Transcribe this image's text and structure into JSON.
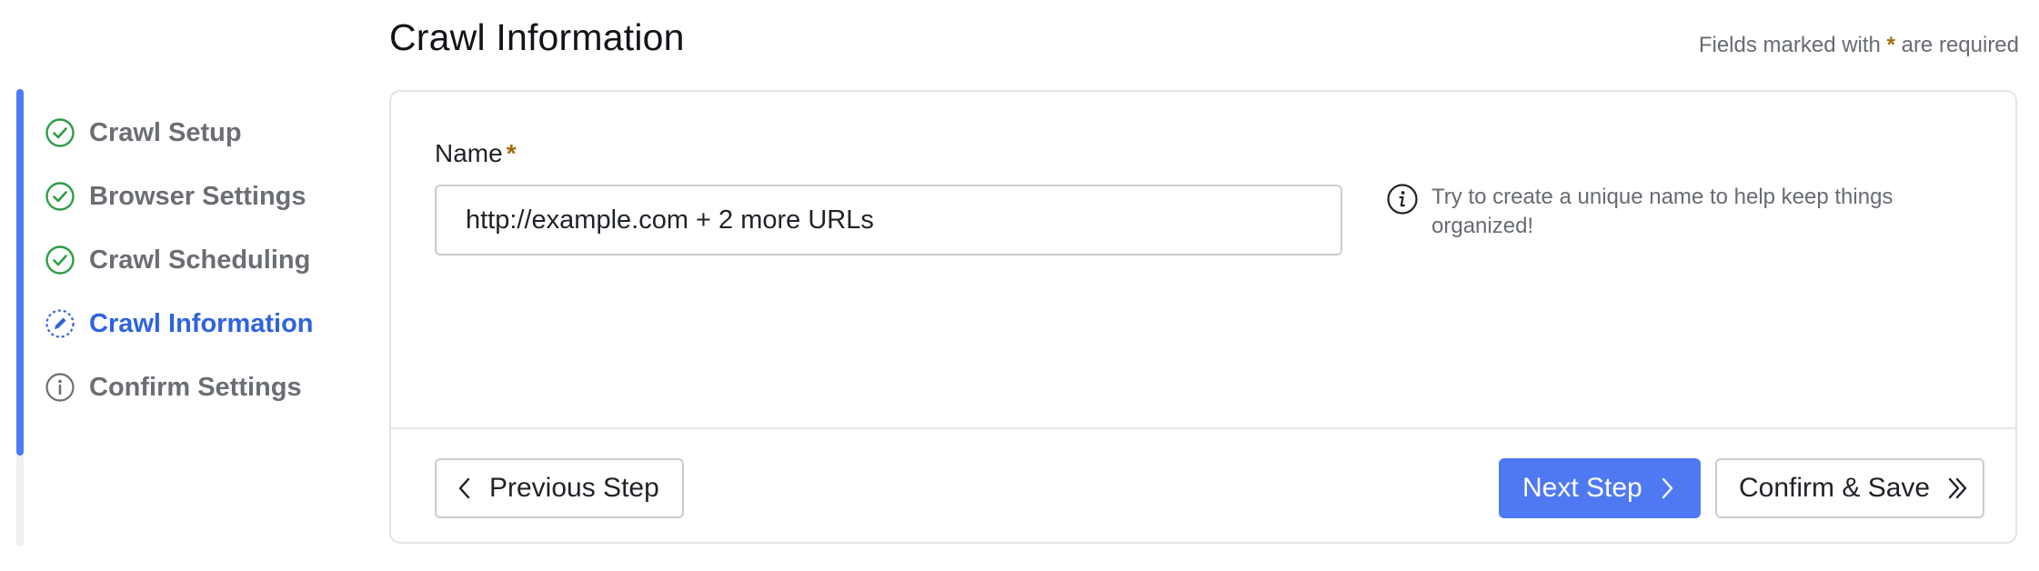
{
  "header": {
    "title": "Crawl Information",
    "required_note_prefix": "Fields marked with ",
    "required_note_star": "*",
    "required_note_suffix": " are required"
  },
  "sidebar": {
    "steps": [
      {
        "label": "Crawl Setup",
        "status": "complete",
        "icon": "check-circle-icon"
      },
      {
        "label": "Browser Settings",
        "status": "complete",
        "icon": "check-circle-icon"
      },
      {
        "label": "Crawl Scheduling",
        "status": "complete",
        "icon": "check-circle-icon"
      },
      {
        "label": "Crawl Information",
        "status": "active",
        "icon": "pencil-circle-icon"
      },
      {
        "label": "Confirm Settings",
        "status": "pending",
        "icon": "info-circle-icon"
      }
    ]
  },
  "form": {
    "name_label": "Name",
    "name_required_star": "*",
    "name_value": "http://example.com + 2 more URLs",
    "hint_text": "Try to create a unique name to help keep things organized!"
  },
  "footer": {
    "previous_label": "Previous Step",
    "next_label": "Next Step",
    "confirm_label": "Confirm & Save"
  },
  "colors": {
    "accent": "#4f79f3",
    "active_text": "#2e63e0",
    "complete": "#2f9e44",
    "required_star": "#a36b0b"
  }
}
